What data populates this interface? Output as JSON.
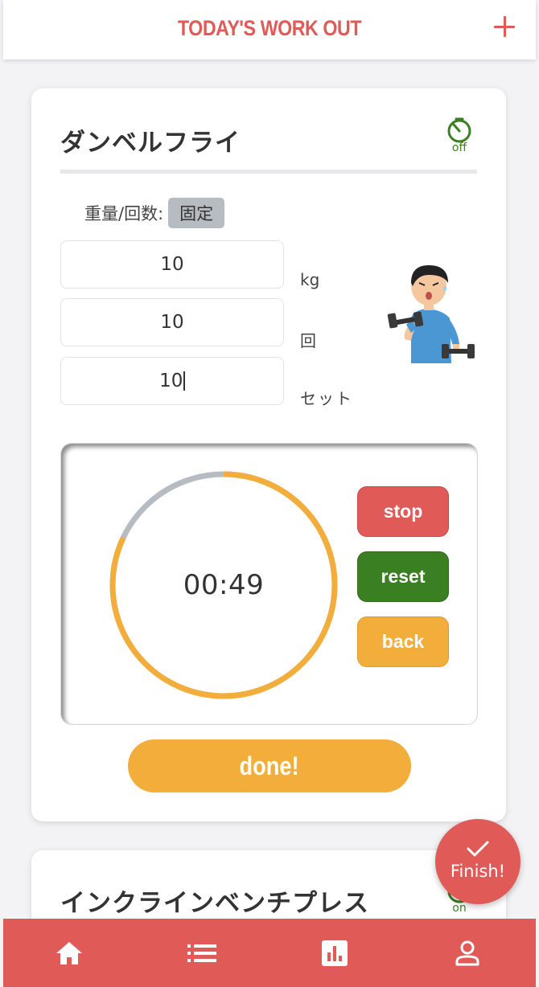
{
  "header": {
    "title": "TODAY'S WORK OUT",
    "add_icon": "plus-icon"
  },
  "colors": {
    "accent": "#e05a57",
    "green": "#3a7f22",
    "orange": "#f2ad3b",
    "gray": "#b7bcc3"
  },
  "exercise1": {
    "name": "ダンベルフライ",
    "timer_toggle": "off",
    "fixed_label": "重量/回数:",
    "fixed_badge": "固定",
    "weight_value": "10",
    "weight_unit": "kg",
    "reps_value": "10",
    "reps_unit": "回",
    "sets_value": "10",
    "sets_unit": "セット",
    "timer": {
      "time": "00:49",
      "progress_fraction": 0.82,
      "stop_label": "stop",
      "reset_label": "reset",
      "back_label": "back"
    },
    "done_label": "done!"
  },
  "exercise2": {
    "name": "インクラインベンチプレス",
    "timer_toggle": "on"
  },
  "finish_button": {
    "label": "Finish!",
    "icon": "check-icon"
  },
  "bottom_nav": [
    {
      "icon": "home-icon"
    },
    {
      "icon": "list-icon"
    },
    {
      "icon": "chart-icon"
    },
    {
      "icon": "profile-icon"
    }
  ]
}
